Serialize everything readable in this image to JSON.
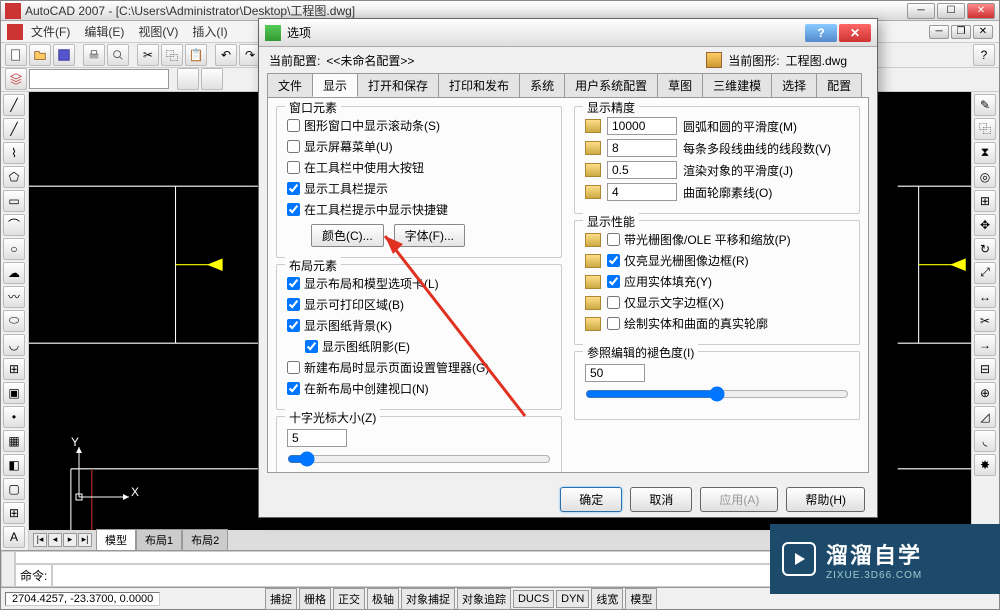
{
  "app": {
    "title": "AutoCAD 2007 - [C:\\Users\\Administrator\\Desktop\\工程图.dwg]",
    "menus": [
      "文件(F)",
      "编辑(E)",
      "视图(V)",
      "插入(I)"
    ]
  },
  "layout_tabs": {
    "active": "模型",
    "tabs": [
      "模型",
      "布局1",
      "布局2"
    ]
  },
  "ucs": {
    "x": "X",
    "y": "Y"
  },
  "command": {
    "prompt": "命令:"
  },
  "status": {
    "coords": "2704.4257, -23.3700, 0.0000",
    "buttons": [
      "捕捉",
      "栅格",
      "正交",
      "极轴",
      "对象捕捉",
      "对象追踪",
      "DUCS",
      "DYN",
      "线宽",
      "模型"
    ]
  },
  "dialog": {
    "title": "选项",
    "profile_label": "当前配置:",
    "profile_value": "<<未命名配置>>",
    "drawing_label": "当前图形:",
    "drawing_value": "工程图.dwg",
    "tabs": [
      "文件",
      "显示",
      "打开和保存",
      "打印和发布",
      "系统",
      "用户系统配置",
      "草图",
      "三维建模",
      "选择",
      "配置"
    ],
    "active_tab": "显示",
    "window_elements": {
      "title": "窗口元素",
      "items": [
        {
          "label": "图形窗口中显示滚动条(S)",
          "checked": false
        },
        {
          "label": "显示屏幕菜单(U)",
          "checked": false
        },
        {
          "label": "在工具栏中使用大按钮",
          "checked": false
        },
        {
          "label": "显示工具栏提示",
          "checked": true
        },
        {
          "label": "在工具栏提示中显示快捷键",
          "checked": true
        }
      ],
      "color_btn": "颜色(C)...",
      "font_btn": "字体(F)..."
    },
    "layout_elements": {
      "title": "布局元素",
      "items": [
        {
          "label": "显示布局和模型选项卡(L)",
          "checked": true
        },
        {
          "label": "显示可打印区域(B)",
          "checked": true
        },
        {
          "label": "显示图纸背景(K)",
          "checked": true
        },
        {
          "label": "显示图纸阴影(E)",
          "checked": true,
          "sub": true
        },
        {
          "label": "新建布局时显示页面设置管理器(G)",
          "checked": false
        },
        {
          "label": "在新布局中创建视口(N)",
          "checked": true
        }
      ]
    },
    "crosshair": {
      "title": "十字光标大小(Z)",
      "value": "5"
    },
    "precision": {
      "title": "显示精度",
      "rows": [
        {
          "value": "10000",
          "label": "圆弧和圆的平滑度(M)"
        },
        {
          "value": "8",
          "label": "每条多段线曲线的线段数(V)"
        },
        {
          "value": "0.5",
          "label": "渲染对象的平滑度(J)"
        },
        {
          "value": "4",
          "label": "曲面轮廓素线(O)"
        }
      ]
    },
    "performance": {
      "title": "显示性能",
      "items": [
        {
          "label": "带光栅图像/OLE 平移和缩放(P)",
          "checked": false
        },
        {
          "label": "仅亮显光栅图像边框(R)",
          "checked": true
        },
        {
          "label": "应用实体填充(Y)",
          "checked": true
        },
        {
          "label": "仅显示文字边框(X)",
          "checked": false
        },
        {
          "label": "绘制实体和曲面的真实轮廓",
          "checked": false
        }
      ]
    },
    "fade": {
      "title": "参照编辑的褪色度(I)",
      "value": "50"
    },
    "buttons": {
      "ok": "确定",
      "cancel": "取消",
      "apply": "应用(A)",
      "help": "帮助(H)"
    }
  },
  "watermark": {
    "main": "溜溜自学",
    "sub": "ZIXUE.3D66.COM"
  }
}
